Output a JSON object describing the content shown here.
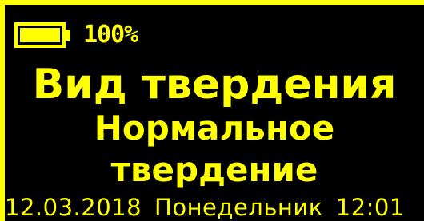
{
  "header": {
    "battery_percent_label": "100%",
    "battery_level": 1.0,
    "battery_icon": "battery-full-icon"
  },
  "main": {
    "title": "Вид твердения",
    "value_line1": "Нормальное",
    "value_line2": "твердение"
  },
  "status_bar": {
    "date": "12.03.2018",
    "weekday": "Понедельник",
    "time": "12:01"
  },
  "colors": {
    "foreground": "#ffff00",
    "background": "#000000"
  }
}
